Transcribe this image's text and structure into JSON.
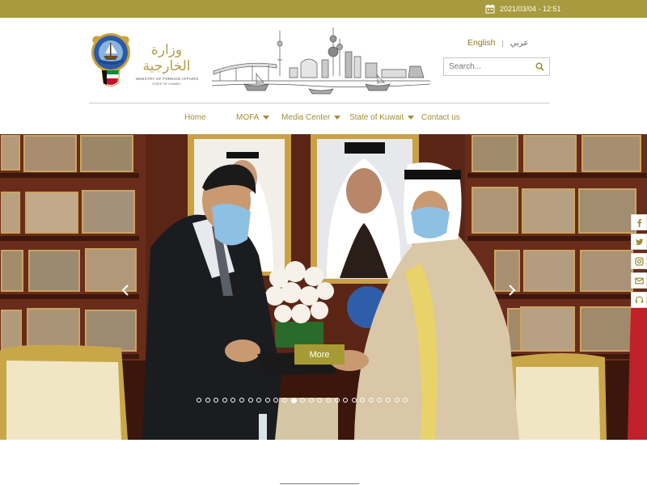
{
  "topbar": {
    "datetime": "2021/03/04 - 12:51",
    "calendar_icon": "calendar-icon",
    "background_color": "#a89a3e"
  },
  "header": {
    "logo": {
      "arabic_text": "وزارة الخارجية",
      "english_line1": "MINISTRY OF FOREIGN AFFAIRS",
      "english_line2": "STATE OF KUWAIT"
    },
    "language": {
      "english": "English",
      "separator": "|",
      "arabic": "عربي"
    },
    "search": {
      "placeholder": "Search...",
      "icon": "search-icon"
    }
  },
  "nav": {
    "items": [
      {
        "label": "Home",
        "has_dropdown": false
      },
      {
        "label": "MOFA",
        "has_dropdown": true
      },
      {
        "label": "Media Center",
        "has_dropdown": true
      },
      {
        "label": "State of Kuwait",
        "has_dropdown": true
      },
      {
        "label": "Contact us",
        "has_dropdown": false
      }
    ],
    "accent_color": "#a08e35"
  },
  "hero": {
    "button_label": "More",
    "button_color": "#a69a34",
    "slide_count": 25,
    "active_slide": 11,
    "prev_icon": "chevron-left-icon",
    "next_icon": "chevron-right-icon"
  },
  "social": {
    "items": [
      "facebook-icon",
      "twitter-icon",
      "instagram-icon",
      "email-icon",
      "headset-icon"
    ]
  }
}
